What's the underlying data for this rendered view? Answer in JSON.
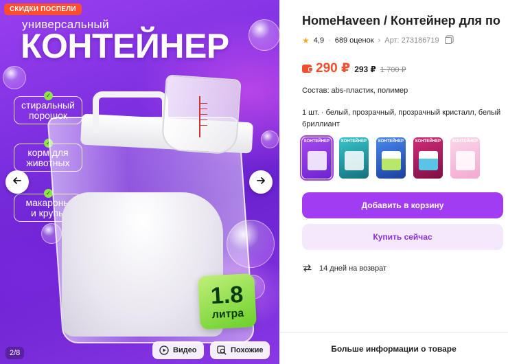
{
  "gallery": {
    "promo_badge": "СКИДКИ ПОСПЕЛИ",
    "hero_subtitle": "универсальный",
    "hero_title": "КОНТЕЙНЕР",
    "features": [
      {
        "line1": "стиральный",
        "line2": "порошок"
      },
      {
        "line1": "корм для",
        "line2": "животных"
      },
      {
        "line1": "макароны",
        "line2": "и крупы"
      }
    ],
    "volume_value": "1.8",
    "volume_unit": "литра",
    "counter": "2/8",
    "video_label": "Видео",
    "similar_label": "Похожие",
    "icons": {
      "prev": "arrow-left-icon",
      "next": "arrow-right-icon",
      "video": "play-icon",
      "similar": "search-image-icon"
    }
  },
  "product": {
    "title": "HomeHaveen / Контейнер для по",
    "rating": "4,9",
    "reviews": "689 оценок",
    "article": "Арт: 273186719",
    "price_now": "290 ₽",
    "price_mid": "293 ₽",
    "price_old": "1 700 ₽",
    "composition": "Состав: abs-пластик, полимер",
    "variants_text": "1 шт. · белый, прозрачный, прозрачный кристалл, белый бриллиант",
    "thumb_title": "КОНТЕЙНЕР",
    "add_to_cart": "Добавить в корзину",
    "buy_now": "Купить сейчас",
    "returns": "14 дней на возврат",
    "more_info": "Больше информации о товаре"
  },
  "colors": {
    "accent": "#a13cf2",
    "price": "#f0502e",
    "badge": "#ff4d2e",
    "star": "#f5a623"
  }
}
